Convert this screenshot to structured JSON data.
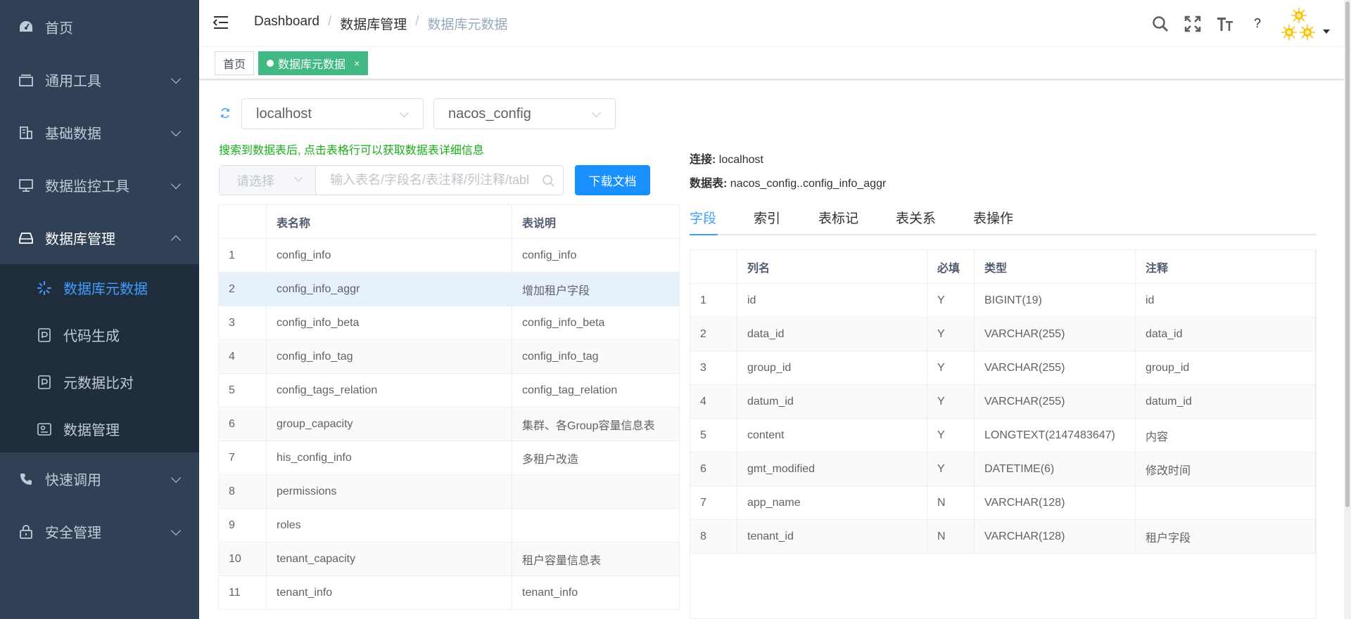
{
  "sidebar": {
    "items": [
      {
        "label": "首页",
        "icon": "dashboard-icon"
      },
      {
        "label": "通用工具",
        "icon": "tools-icon"
      },
      {
        "label": "基础数据",
        "icon": "building-icon"
      },
      {
        "label": "数据监控工具",
        "icon": "monitor-icon"
      },
      {
        "label": "数据库管理",
        "icon": "database-icon"
      },
      {
        "label": "快速调用",
        "icon": "phone-icon"
      },
      {
        "label": "安全管理",
        "icon": "lock-icon"
      }
    ],
    "sub_items": [
      {
        "label": "数据库元数据",
        "icon": "loading-icon"
      },
      {
        "label": "代码生成",
        "icon": "code-icon"
      },
      {
        "label": "元数据比对",
        "icon": "compare-icon"
      },
      {
        "label": "数据管理",
        "icon": "data-manage-icon"
      }
    ],
    "active_color": "#409eff",
    "bg_color": "#304156"
  },
  "navbar": {
    "breadcrumb": [
      "Dashboard",
      "数据库管理",
      "数据库元数据"
    ],
    "help_label": "?"
  },
  "tags": {
    "home": "首页",
    "active": "数据库元数据",
    "close": "×"
  },
  "toolbar": {
    "connection": "localhost",
    "database": "nacos_config",
    "hint": "搜索到数据表后, 点击表格行可以获取数据表详细信息",
    "search_prefix": "请选择",
    "search_placeholder": "输入表名/字段名/表注释/列注释/tabl",
    "download_label": "下载文档"
  },
  "left_table": {
    "headers": [
      "",
      "表名称",
      "表说明"
    ],
    "rows": [
      {
        "idx": "1",
        "name": "config_info",
        "desc": "config_info"
      },
      {
        "idx": "2",
        "name": "config_info_aggr",
        "desc": "增加租户字段"
      },
      {
        "idx": "3",
        "name": "config_info_beta",
        "desc": "config_info_beta"
      },
      {
        "idx": "4",
        "name": "config_info_tag",
        "desc": "config_info_tag"
      },
      {
        "idx": "5",
        "name": "config_tags_relation",
        "desc": "config_tag_relation"
      },
      {
        "idx": "6",
        "name": "group_capacity",
        "desc": "集群、各Group容量信息表"
      },
      {
        "idx": "7",
        "name": "his_config_info",
        "desc": "多租户改造"
      },
      {
        "idx": "8",
        "name": "permissions",
        "desc": ""
      },
      {
        "idx": "9",
        "name": "roles",
        "desc": ""
      },
      {
        "idx": "10",
        "name": "tenant_capacity",
        "desc": "租户容量信息表"
      },
      {
        "idx": "11",
        "name": "tenant_info",
        "desc": "tenant_info"
      }
    ]
  },
  "detail": {
    "connection_label": "连接:",
    "connection_value": "localhost",
    "table_label": "数据表:",
    "table_value": "nacos_config..config_info_aggr",
    "tabs": [
      "字段",
      "索引",
      "表标记",
      "表关系",
      "表操作"
    ]
  },
  "right_table": {
    "headers": [
      "",
      "列名",
      "必填",
      "类型",
      "注释"
    ],
    "rows": [
      {
        "idx": "1",
        "col": "id",
        "req": "Y",
        "type": "BIGINT(19)",
        "comment": "id"
      },
      {
        "idx": "2",
        "col": "data_id",
        "req": "Y",
        "type": "VARCHAR(255)",
        "comment": "data_id"
      },
      {
        "idx": "3",
        "col": "group_id",
        "req": "Y",
        "type": "VARCHAR(255)",
        "comment": "group_id"
      },
      {
        "idx": "4",
        "col": "datum_id",
        "req": "Y",
        "type": "VARCHAR(255)",
        "comment": "datum_id"
      },
      {
        "idx": "5",
        "col": "content",
        "req": "Y",
        "type": "LONGTEXT(2147483647)",
        "comment": "内容"
      },
      {
        "idx": "6",
        "col": "gmt_modified",
        "req": "Y",
        "type": "DATETIME(6)",
        "comment": "修改时间"
      },
      {
        "idx": "7",
        "col": "app_name",
        "req": "N",
        "type": "VARCHAR(128)",
        "comment": ""
      },
      {
        "idx": "8",
        "col": "tenant_id",
        "req": "N",
        "type": "VARCHAR(128)",
        "comment": "租户字段"
      }
    ]
  },
  "colors": {
    "primary": "#409eff",
    "button": "#1890ff",
    "tag_active": "#42b983",
    "hint": "#1aad19",
    "selected_row": "#e6f1fc"
  }
}
